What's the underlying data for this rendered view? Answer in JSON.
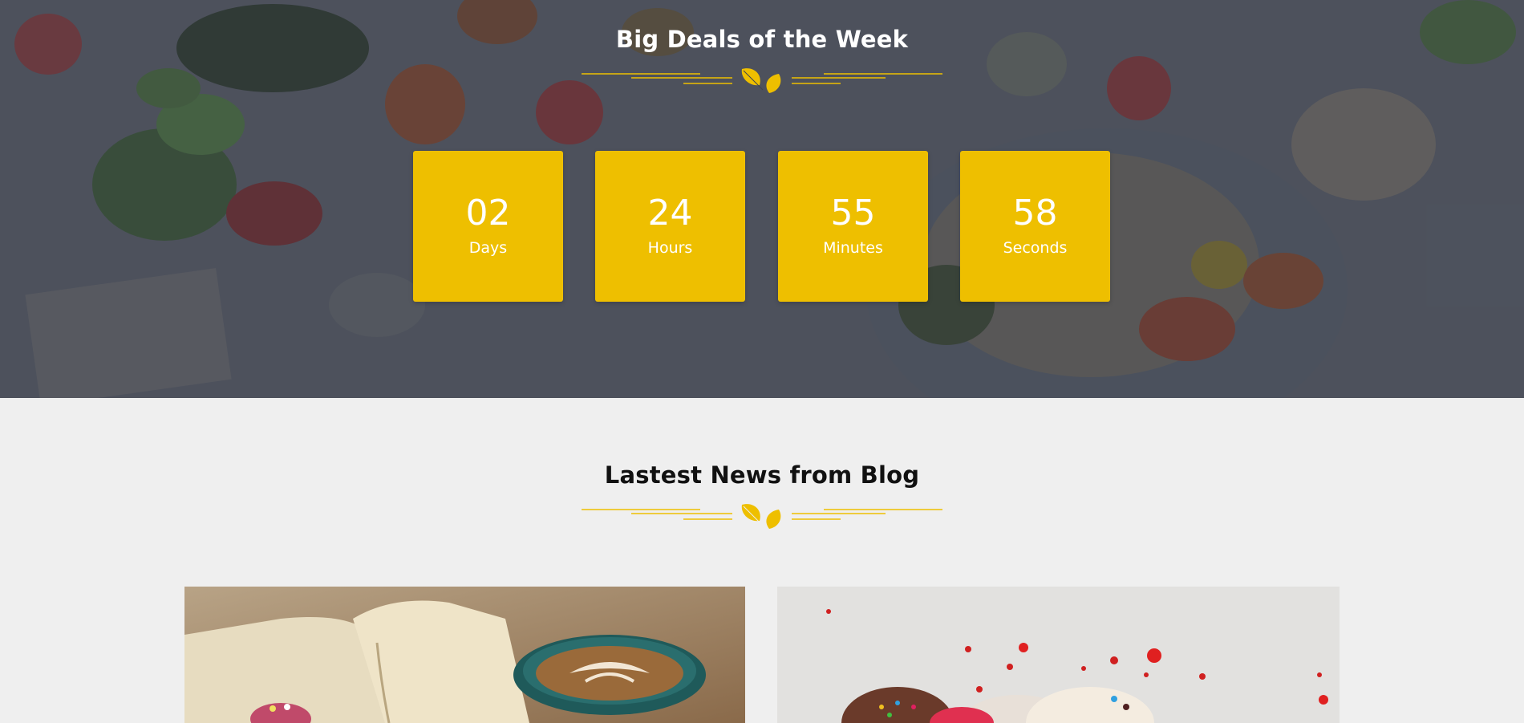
{
  "deals": {
    "title": "Big Deals of the Week",
    "countdown": [
      {
        "value": "02",
        "unit": "Days"
      },
      {
        "value": "24",
        "unit": "Hours"
      },
      {
        "value": "55",
        "unit": "Minutes"
      },
      {
        "value": "58",
        "unit": "Seconds"
      }
    ]
  },
  "blog": {
    "title": "Lastest News from Blog"
  },
  "colors": {
    "accent": "#eebf00",
    "overlay": "#3d4350",
    "page_bg": "#efefef",
    "title_dark": "#111111"
  },
  "icons": {
    "divider": "leaf-divider-icon"
  }
}
